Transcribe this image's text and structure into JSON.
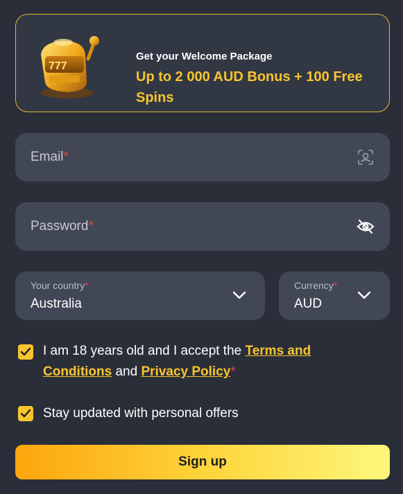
{
  "promo": {
    "kicker": "Get your Welcome Package",
    "headline": "Up to 2 000 AUD Bonus + 100 Free Spins",
    "image_icon": "golden-slot-machine",
    "accent_color": "#f7c52e"
  },
  "email": {
    "label": "Email",
    "required_mark": "*",
    "icon": "face-scan-icon"
  },
  "password": {
    "label": "Password",
    "required_mark": "*",
    "icon": "eye-slash-icon"
  },
  "country": {
    "label": "Your country",
    "required_mark": "*",
    "value": "Australia",
    "icon": "chevron-down-icon"
  },
  "currency": {
    "label": "Currency",
    "required_mark": "*",
    "value": "AUD",
    "icon": "chevron-down-icon"
  },
  "terms": {
    "checked": true,
    "text_before": "I am 18 years old and I accept the ",
    "terms_link": "Terms and Conditions",
    "text_middle": " and ",
    "privacy_link": "Privacy Policy",
    "required_mark": "*"
  },
  "offers": {
    "checked": true,
    "text": "Stay updated with personal offers"
  },
  "signup": {
    "label": "Sign up"
  }
}
